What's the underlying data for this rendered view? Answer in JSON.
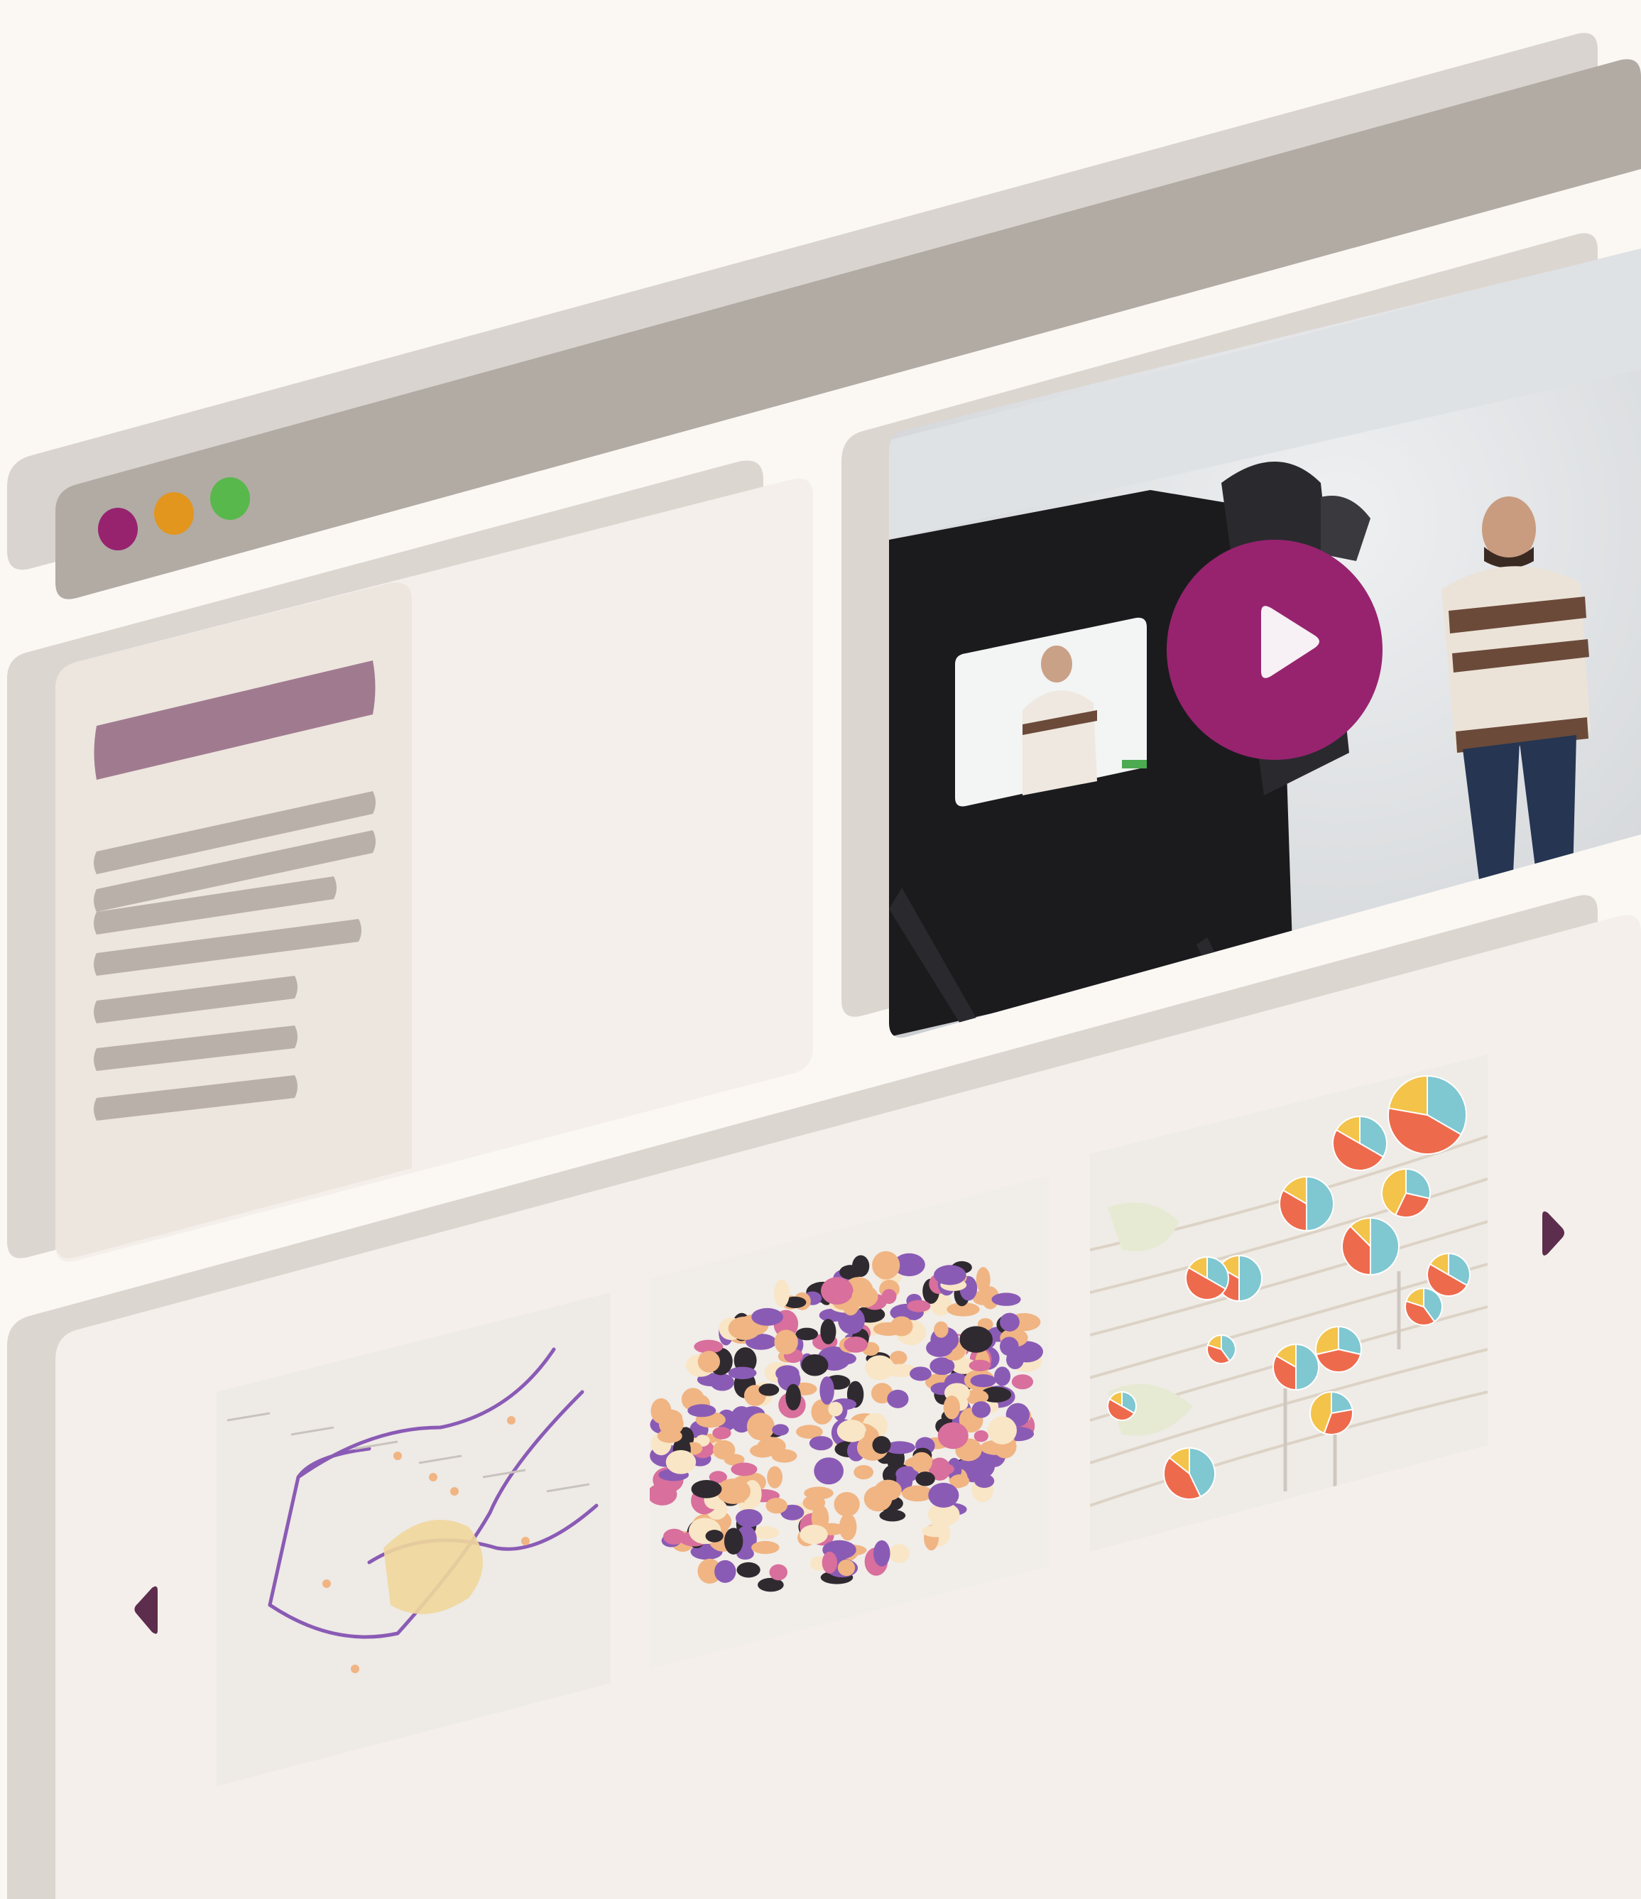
{
  "browser": {
    "window_controls": [
      {
        "name": "close",
        "color": "#97236f"
      },
      {
        "name": "minimize",
        "color": "#e2961e"
      },
      {
        "name": "maximize",
        "color": "#59b84c"
      }
    ]
  },
  "theme": {
    "accent": "#97236f",
    "menu_highlight": "#a07b90",
    "menu_line": "#b9b0a9",
    "chrome_bar": "#b1aba4",
    "chrome_shadow": "#d9d4cf",
    "panel": "#f4efea",
    "panel_shadow": "#dcd6d1",
    "sidebar": "#ede6de",
    "arrow": "#5c2d4c"
  },
  "sidebar": {
    "menu_items": [
      {
        "name": "sidebar-menu-item-active",
        "active": true
      },
      {
        "name": "sidebar-menu-line",
        "active": false
      },
      {
        "name": "sidebar-menu-line",
        "active": false
      },
      {
        "name": "sidebar-menu-line",
        "active": false
      },
      {
        "name": "sidebar-menu-line",
        "active": false
      },
      {
        "name": "sidebar-menu-line",
        "active": false
      },
      {
        "name": "sidebar-menu-line",
        "active": false
      },
      {
        "name": "sidebar-menu-line",
        "active": false
      }
    ]
  },
  "video": {
    "play_icon": "play-icon",
    "play_color": "#97236f"
  },
  "carousel": {
    "prev_icon": "chevron-left-icon",
    "next_icon": "chevron-right-icon",
    "slides": [
      {
        "kind": "road-map",
        "name": "map-thumbnail-roads"
      },
      {
        "kind": "choropleth-map",
        "name": "map-thumbnail-choropleth"
      },
      {
        "kind": "pie-map",
        "name": "map-thumbnail-pies"
      }
    ],
    "palette": {
      "purple": "#8a5bb5",
      "pink": "#d86f9c",
      "peach": "#f0b583",
      "cream": "#f8e6c6",
      "dark": "#2f2a2f",
      "teal": "#7fc7d1",
      "coral": "#ee6a4c",
      "yellow": "#f3c34a"
    }
  }
}
